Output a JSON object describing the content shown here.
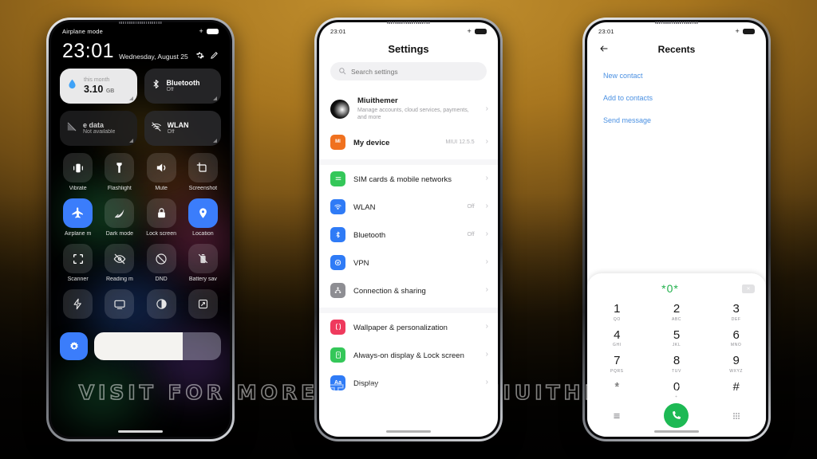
{
  "background": {
    "accent_gold": "#b8851f",
    "dark": "#0c0905"
  },
  "watermark": {
    "text": "VISIT FOR MORE THEMES - MIUITHEMER.COM"
  },
  "phone1": {
    "name": "control-center",
    "status": {
      "label": "Airplane mode",
      "plus": "+",
      "time_hidden": ""
    },
    "clock": {
      "time": "23:01",
      "date": "Wednesday, August 25"
    },
    "header_icons": [
      "gear-icon",
      "edit-pencil-icon"
    ],
    "big_tiles": [
      {
        "id": "data-usage",
        "kind": "data",
        "top": "this month",
        "value": "3.10",
        "unit": "GB",
        "icon": "water-drop-icon"
      },
      {
        "id": "bluetooth",
        "kind": "normal",
        "title": "Bluetooth",
        "sub": "Off",
        "icon": "bluetooth-icon"
      },
      {
        "id": "mobile-data",
        "kind": "normal",
        "title": "e data",
        "sub": "Not available",
        "icon": "mobile-data-off-icon"
      },
      {
        "id": "wlan",
        "kind": "normal",
        "title": "WLAN",
        "sub": "Off",
        "icon": "wifi-off-icon"
      }
    ],
    "tiles": [
      {
        "label": "Vibrate",
        "icon": "vibrate-icon",
        "on": false
      },
      {
        "label": "Flashlight",
        "icon": "flashlight-icon",
        "on": false
      },
      {
        "label": "Mute",
        "icon": "volume-icon",
        "on": false
      },
      {
        "label": "Screenshot",
        "icon": "screenshot-icon",
        "on": false
      },
      {
        "label": "Airplane m",
        "icon": "airplane-icon",
        "on": true
      },
      {
        "label": "Dark mode",
        "icon": "dark-mode-icon",
        "on": false
      },
      {
        "label": "Lock screen",
        "icon": "lock-icon",
        "on": false
      },
      {
        "label": "Location",
        "icon": "location-pin-icon",
        "on": true
      },
      {
        "label": "Scanner",
        "icon": "scanner-icon",
        "on": false
      },
      {
        "label": "Reading m",
        "icon": "reading-mode-icon",
        "on": false
      },
      {
        "label": "DND",
        "icon": "dnd-icon",
        "on": false
      },
      {
        "label": "Battery sav",
        "icon": "battery-saver-icon",
        "on": false
      },
      {
        "label": "",
        "icon": "lightning-icon",
        "on": false
      },
      {
        "label": "",
        "icon": "cast-screen-icon",
        "on": false
      },
      {
        "label": "",
        "icon": "contrast-icon",
        "on": false
      },
      {
        "label": "",
        "icon": "expand-icon",
        "on": false
      }
    ],
    "brightness": {
      "auto_icon": "auto-brightness-icon",
      "percent": 70
    }
  },
  "phone2": {
    "name": "settings",
    "status": {
      "time": "23:01",
      "plus": "+"
    },
    "title": "Settings",
    "search": {
      "placeholder": "Search settings",
      "value": "",
      "icon": "search-icon"
    },
    "account": {
      "name": "Miuithemer",
      "desc": "Manage accounts, cloud services, payments, and more",
      "icon": "avatar"
    },
    "device": {
      "label": "My device",
      "value": "MIUI 12.5.5",
      "icon": "mi-logo-icon",
      "color": "#f0711f"
    },
    "groups": [
      {
        "rows": [
          {
            "label": "SIM cards & mobile networks",
            "value": "",
            "icon": "sim-card-icon",
            "color": "#34c759"
          },
          {
            "label": "WLAN",
            "value": "Off",
            "icon": "wifi-icon",
            "color": "#2f7bf6"
          },
          {
            "label": "Bluetooth",
            "value": "Off",
            "icon": "bluetooth-icon",
            "color": "#2f7bf6"
          },
          {
            "label": "VPN",
            "value": "",
            "icon": "vpn-icon",
            "color": "#2f7bf6"
          },
          {
            "label": "Connection & sharing",
            "value": "",
            "icon": "sharing-icon",
            "color": "#8e8e93"
          }
        ]
      },
      {
        "rows": [
          {
            "label": "Wallpaper & personalization",
            "value": "",
            "icon": "wallpaper-icon",
            "color": "#ef3a5d"
          },
          {
            "label": "Always-on display & Lock screen",
            "value": "",
            "icon": "aod-lock-icon",
            "color": "#34c759"
          },
          {
            "label": "Display",
            "value": "",
            "icon": "display-icon",
            "color": "#2f7bf6"
          }
        ]
      }
    ]
  },
  "phone3": {
    "name": "recents-dialer",
    "status": {
      "time": "23:01",
      "plus": "+"
    },
    "title": "Recents",
    "back_icon": "arrow-left-icon",
    "links": [
      "New contact",
      "Add to contacts",
      "Send message"
    ],
    "dial": {
      "number": "*0*",
      "number_color": "#22b14c",
      "delete_icon": "backspace-icon",
      "keys": [
        {
          "digit": "1",
          "letters": "QO"
        },
        {
          "digit": "2",
          "letters": "ABC"
        },
        {
          "digit": "3",
          "letters": "DEF"
        },
        {
          "digit": "4",
          "letters": "GHI"
        },
        {
          "digit": "5",
          "letters": "JKL"
        },
        {
          "digit": "6",
          "letters": "MNO"
        },
        {
          "digit": "7",
          "letters": "PQRS"
        },
        {
          "digit": "8",
          "letters": "TUV"
        },
        {
          "digit": "9",
          "letters": "WXYZ"
        },
        {
          "digit": "*",
          "letters": ""
        },
        {
          "digit": "0",
          "letters": "+"
        },
        {
          "digit": "#",
          "letters": ""
        }
      ],
      "bottom": {
        "menu_icon": "menu-lines-icon",
        "call_icon": "phone-call-icon",
        "keypad_icon": "keypad-icon"
      }
    }
  }
}
